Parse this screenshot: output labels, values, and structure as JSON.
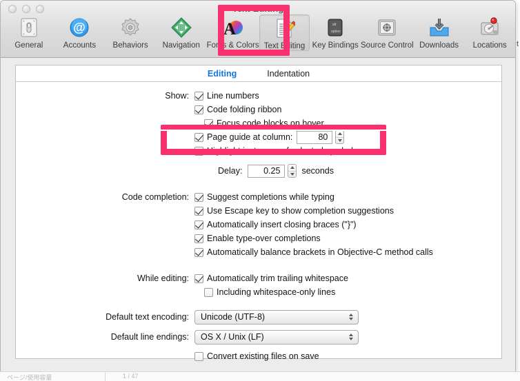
{
  "window": {
    "title": "Text Editing",
    "traffic_lights": [
      "close",
      "minimize",
      "zoom"
    ]
  },
  "toolbar": {
    "items": [
      {
        "label": "General",
        "icon": "switch-icon",
        "selected": false
      },
      {
        "label": "Accounts",
        "icon": "at-sign-icon",
        "selected": false
      },
      {
        "label": "Behaviors",
        "icon": "gear-icon",
        "selected": false
      },
      {
        "label": "Navigation",
        "icon": "compass-arrows-icon",
        "selected": false
      },
      {
        "label": "Fonts & Colors",
        "icon": "font-color-icon",
        "selected": false
      },
      {
        "label": "Text Editing",
        "icon": "document-pencil-icon",
        "selected": true
      },
      {
        "label": "Key Bindings",
        "icon": "keyboard-key-icon",
        "selected": false
      },
      {
        "label": "Source Control",
        "icon": "safe-vault-icon",
        "selected": false
      },
      {
        "label": "Downloads",
        "icon": "download-tray-icon",
        "selected": false
      },
      {
        "label": "Locations",
        "icon": "hard-disk-icon",
        "selected": false
      }
    ]
  },
  "tabs": [
    {
      "label": "Editing",
      "active": true
    },
    {
      "label": "Indentation",
      "active": false
    }
  ],
  "form": {
    "show": {
      "label": "Show:",
      "options": [
        {
          "label": "Line numbers",
          "checked": true
        },
        {
          "label": "Code folding ribbon",
          "checked": true
        },
        {
          "label": "Focus code blocks on hover",
          "checked": true
        },
        {
          "label": "Page guide at column:",
          "checked": true
        },
        {
          "label": "Highlight instances of selected symbol",
          "checked": true
        }
      ],
      "page_guide_column": "80",
      "delay_label": "Delay:",
      "delay_value": "0.25",
      "delay_suffix": "seconds"
    },
    "code_completion": {
      "label": "Code completion:",
      "options": [
        {
          "label": "Suggest completions while typing",
          "checked": true
        },
        {
          "label": "Use Escape key to show completion suggestions",
          "checked": true
        },
        {
          "label": "Automatically insert closing braces (\"}\")",
          "checked": true
        },
        {
          "label": "Enable type-over completions",
          "checked": true
        },
        {
          "label": "Automatically balance brackets in Objective-C method calls",
          "checked": true
        }
      ]
    },
    "while_editing": {
      "label": "While editing:",
      "options": [
        {
          "label": "Automatically trim trailing whitespace",
          "checked": true
        },
        {
          "label": "Including whitespace-only lines",
          "checked": false
        }
      ]
    },
    "default_text_encoding": {
      "label": "Default text encoding:",
      "value": "Unicode (UTF-8)"
    },
    "default_line_endings": {
      "label": "Default line endings:",
      "value": "OS X / Unix (LF)",
      "convert_label": "Convert existing files on save",
      "convert_checked": false
    }
  },
  "annotations": {
    "color": "#fa2f6e",
    "boxes": [
      {
        "name": "text-editing-toolbar-highlight"
      },
      {
        "name": "page-guide-row-highlight"
      }
    ]
  },
  "background": {
    "right_edge_text": "t",
    "bottom_cell_a": "ページ/使用容量",
    "bottom_cell_b": "1 / 47"
  }
}
